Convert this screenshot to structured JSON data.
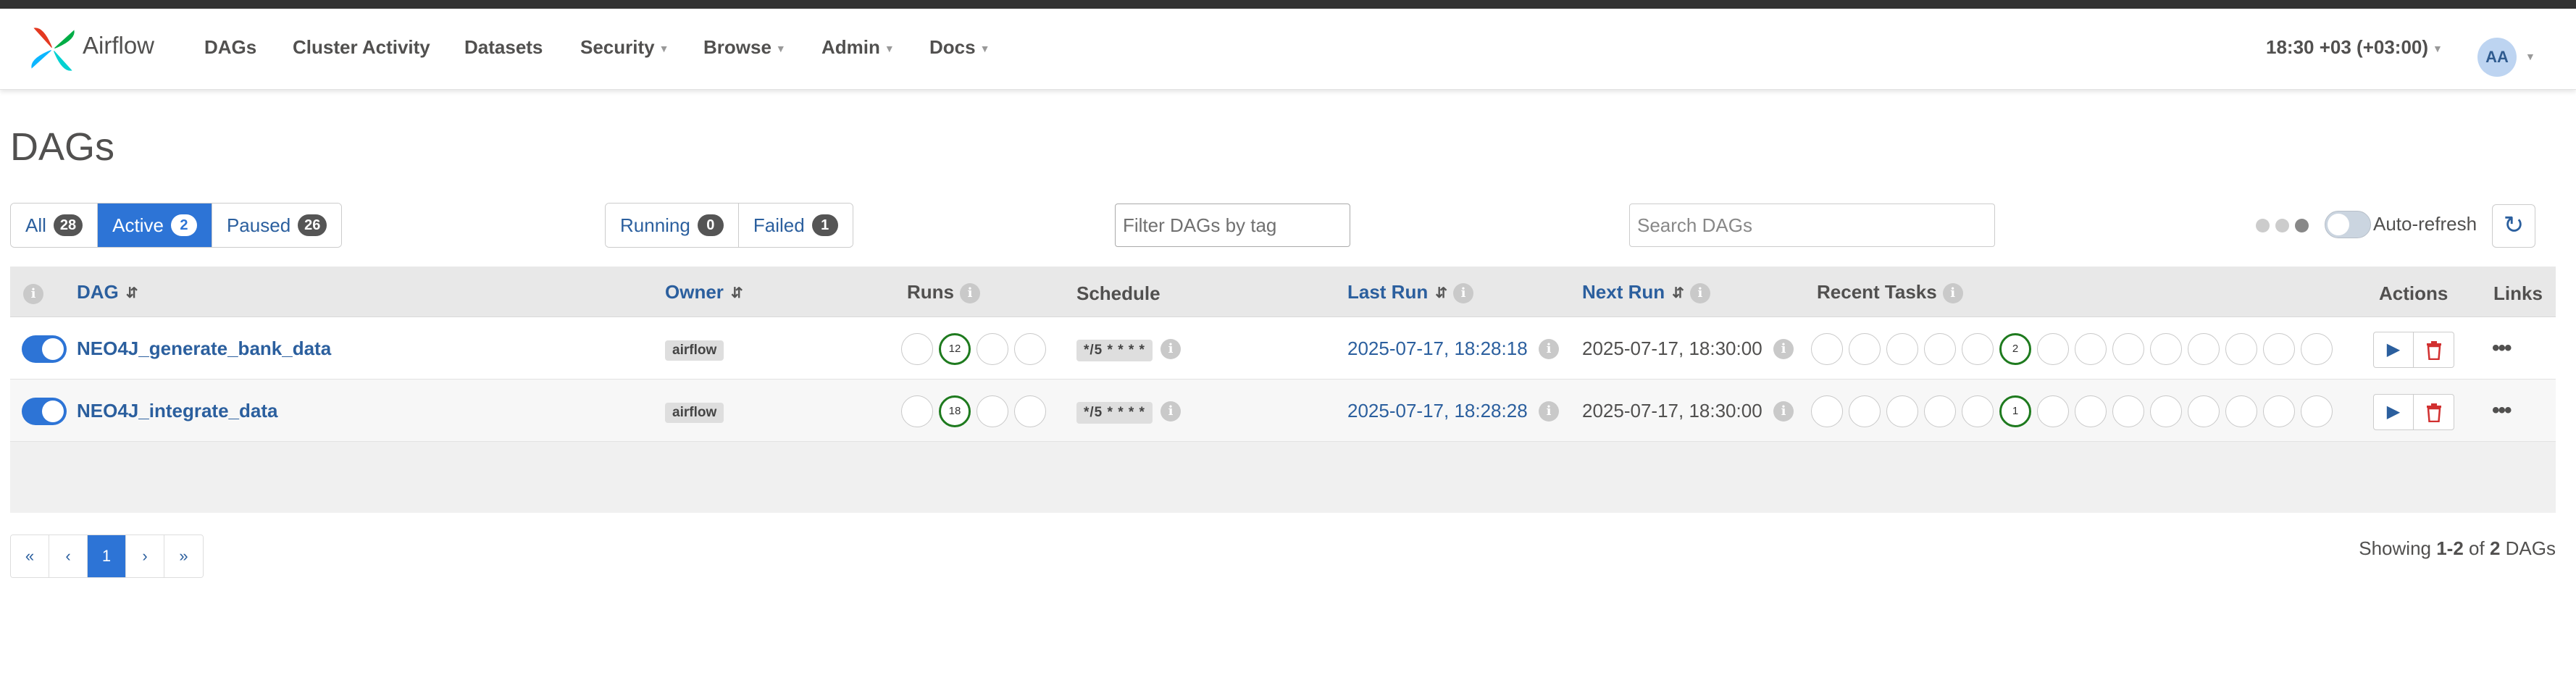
{
  "navbar": {
    "brand": "Airflow",
    "items": [
      "DAGs",
      "Cluster Activity",
      "Datasets",
      "Security",
      "Browse",
      "Admin",
      "Docs"
    ],
    "clock": "18:30 +03 (+03:00)",
    "user_initials": "AA"
  },
  "page": {
    "title": "DAGs"
  },
  "filters": {
    "status": [
      {
        "label": "All",
        "count": "28"
      },
      {
        "label": "Active",
        "count": "2"
      },
      {
        "label": "Paused",
        "count": "26"
      }
    ],
    "run_state": [
      {
        "label": "Running",
        "count": "0"
      },
      {
        "label": "Failed",
        "count": "1"
      }
    ],
    "tag_placeholder": "Filter DAGs by tag",
    "search_placeholder": "Search DAGs",
    "auto_refresh_label": "Auto-refresh"
  },
  "table": {
    "headers": {
      "dag": "DAG",
      "owner": "Owner",
      "runs": "Runs",
      "schedule": "Schedule",
      "last_run": "Last Run",
      "next_run": "Next Run",
      "recent_tasks": "Recent Tasks",
      "actions": "Actions",
      "links": "Links"
    },
    "rows": [
      {
        "dag_id": "NEO4J_generate_bank_data",
        "owner": "airflow",
        "runs_success": "12",
        "schedule": "*/5 * * * *",
        "last_run": "2025-07-17, 18:28:18",
        "next_run": "2025-07-17, 18:30:00",
        "recent_tasks_success": "2"
      },
      {
        "dag_id": "NEO4J_integrate_data",
        "owner": "airflow",
        "runs_success": "18",
        "schedule": "*/5 * * * *",
        "last_run": "2025-07-17, 18:28:28",
        "next_run": "2025-07-17, 18:30:00",
        "recent_tasks_success": "1"
      }
    ]
  },
  "pagination": {
    "first": "«",
    "prev": "‹",
    "current": "1",
    "next": "›",
    "last": "»",
    "showing_prefix": "Showing",
    "showing_range": "1-2",
    "showing_of": "of",
    "showing_total": "2",
    "showing_suffix": "DAGs"
  },
  "colors": {
    "primary": "#2d74d6",
    "link": "#2b5f9e",
    "success": "#1e7a1e",
    "danger": "#d13030",
    "header_bar": "#333333"
  },
  "icons": {
    "logo": "airflow-pinwheel-icon",
    "info": "info-icon",
    "sort": "sort-icon",
    "play": "play-icon",
    "delete": "trash-icon",
    "more": "more-dots-icon",
    "refresh": "refresh-icon"
  }
}
